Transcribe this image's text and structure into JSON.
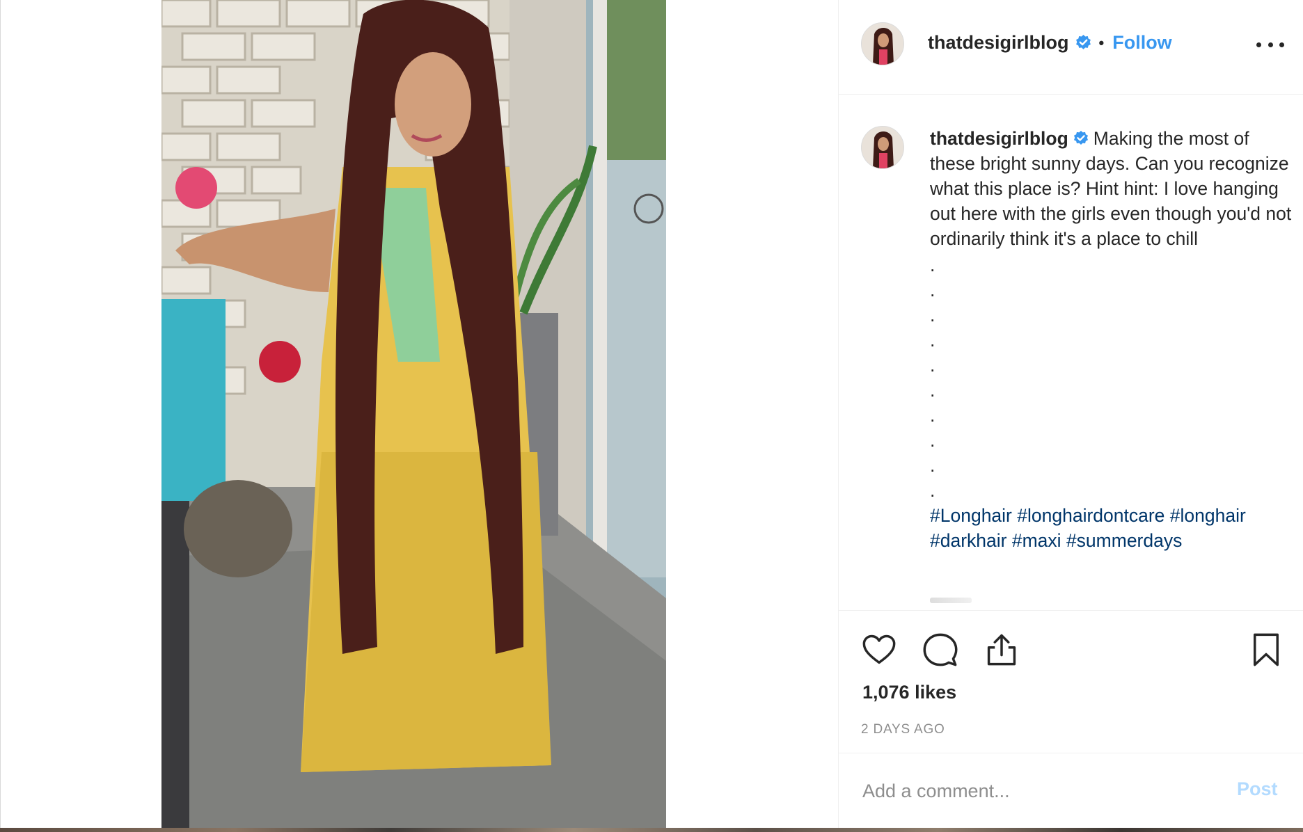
{
  "post": {
    "username": "thatdesigirlblog",
    "verified": true,
    "follow_label": "Follow",
    "separator": "•",
    "more_icon": "more-horizontal-icon",
    "photo_alt": "post-photo"
  },
  "caption": {
    "author": "thatdesigirlblog",
    "text": "Making the most of these bright sunny days. Can you recognize what this place is? Hint hint: I love hanging out here with the girls even though you'd not ordinarily think it's a place to chill",
    "dots": [
      ".",
      ".",
      ".",
      ".",
      ".",
      ".",
      ".",
      ".",
      ".",
      "."
    ],
    "hashtags": [
      "#Longhair",
      "#longhairdontcare",
      "#longhair",
      "#darkhair",
      "#maxi",
      "#summerdays"
    ]
  },
  "actions": {
    "like_icon": "heart-icon",
    "comment_icon": "comment-bubble-icon",
    "share_icon": "share-upload-icon",
    "save_icon": "bookmark-icon"
  },
  "stats": {
    "likes": "1,076 likes",
    "timestamp": "2 DAYS AGO"
  },
  "comment_form": {
    "placeholder": "Add a comment...",
    "post_label": "Post"
  },
  "colors": {
    "link_blue": "#3897f0",
    "hashtag_blue": "#003569",
    "post_disabled": "#b3dbff",
    "text": "#262626",
    "muted": "#8e8e8e",
    "border": "#efefef"
  }
}
